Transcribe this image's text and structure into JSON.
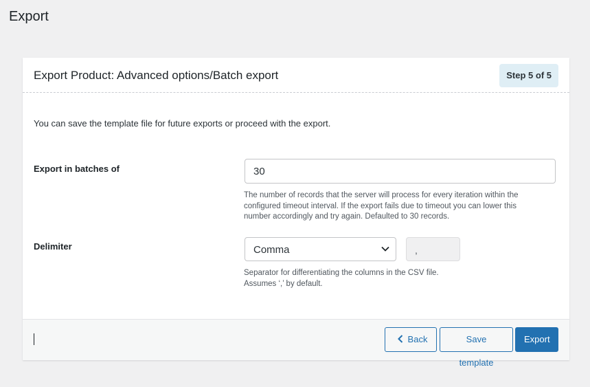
{
  "page": {
    "title": "Export"
  },
  "card": {
    "title": "Export Product: Advanced options/Batch export",
    "step": "Step 5 of 5",
    "intro": "You can save the template file for future exports or proceed with the export."
  },
  "batch": {
    "label": "Export in batches of",
    "value": "30",
    "help_lines": [
      "The number of records that the server will process for every iteration within the",
      "configured timeout interval. If the export fails due to timeout you can lower this",
      "number accordingly and try again. Defaulted to 30 records."
    ]
  },
  "delimiter": {
    "label": "Delimiter",
    "selected": "Comma",
    "value": ",",
    "help_lines": [
      "Separator for differentiating the columns in the CSV file.",
      "Assumes ‘,’ by default."
    ]
  },
  "footer": {
    "back_label": "Back",
    "save_label": "Save template",
    "export_label": "Export"
  },
  "colors": {
    "primary": "#2271b1",
    "badge_bg": "#dfeef5",
    "page_bg": "#f0f0f1"
  },
  "icons": {
    "back": "chevron-left-icon",
    "select": "chevron-down-icon"
  }
}
